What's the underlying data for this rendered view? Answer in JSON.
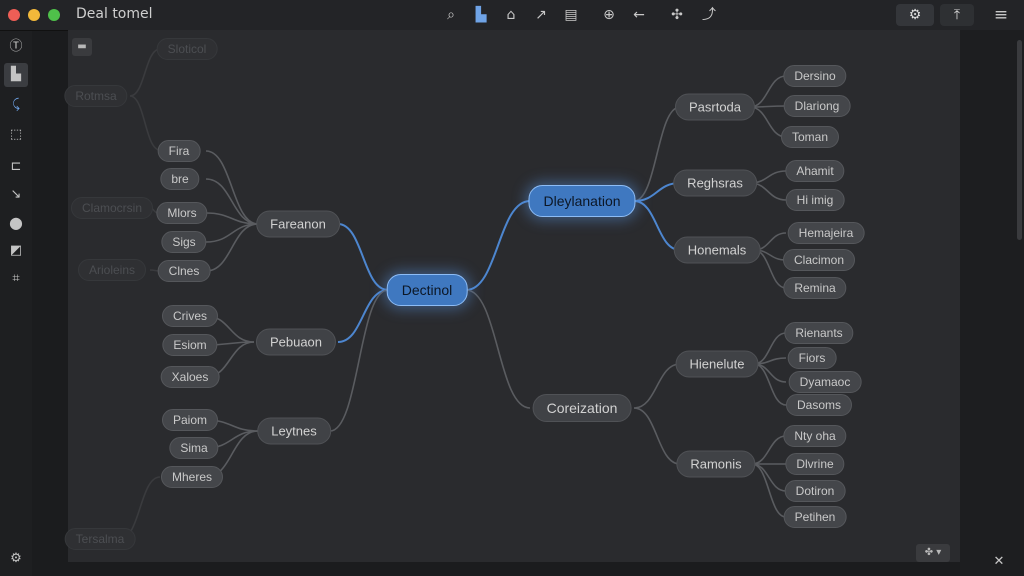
{
  "app": {
    "title": "Deal tomel"
  },
  "toolbar": {
    "icons": [
      "select-icon",
      "frame-icon",
      "home-icon",
      "pen-icon",
      "layers-icon",
      "zoom-icon",
      "back-icon",
      "move-icon",
      "connector-icon"
    ],
    "right_icons": [
      "settings-icon",
      "upload-icon",
      "menu-icon"
    ]
  },
  "mindmap": {
    "center": "Dectinol",
    "main_right": [
      {
        "label": "Dleylanation",
        "highlight": true
      },
      {
        "label": "Coreization",
        "highlight": false
      }
    ],
    "right_branches": [
      {
        "label": "Pasrtoda",
        "leaves": [
          "Dersino",
          "Dlariong",
          "Toman"
        ]
      },
      {
        "label": "Reghsras",
        "leaves": [
          "Ahamit",
          "Hi imig"
        ]
      },
      {
        "label": "Honemals",
        "leaves": [
          "Hemajeira",
          "Clacimon",
          "Remina"
        ]
      },
      {
        "label": "Hienelute",
        "leaves": [
          "Rienants",
          "Fiors",
          "Dyamaoc",
          "Dasoms"
        ]
      },
      {
        "label": "Ramonis",
        "leaves": [
          "Nty oha",
          "Dlvrine",
          "Dotiron",
          "Petihen"
        ]
      }
    ],
    "left_branches": [
      {
        "label": "Fareanon",
        "leaves": [
          "Fira",
          "bre",
          "Mlors",
          "Sigs",
          "Clnes"
        ]
      },
      {
        "label": "Pebuaon",
        "leaves": [
          "Crives",
          "Esiom",
          "Xaloes"
        ]
      },
      {
        "label": "Leytnes",
        "leaves": [
          "Paiom",
          "Sima",
          "Mheres"
        ]
      }
    ],
    "faint_nodes": [
      "Sloticol",
      "Rotmsa",
      "Clamocrsin",
      "Arioleins",
      "Tersalma"
    ]
  },
  "colors": {
    "accent": "#3f78c0",
    "accent_link": "#4d86cf",
    "link": "#5a5c60"
  }
}
